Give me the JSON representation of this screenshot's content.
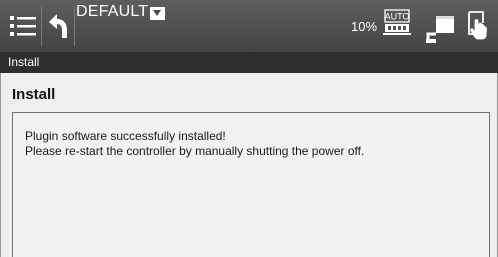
{
  "toolbar": {
    "menu_icon": "menu-icon",
    "undo_icon": "undo-icon",
    "profile_label": "DEFAULT",
    "profile_dropdown_icon": "dropdown-arrow-icon",
    "percent": "10%",
    "auto_icon": "auto-mode-icon",
    "monitor_icon": "display-monitor-icon",
    "hand_icon": "hand-touch-icon"
  },
  "breadcrumb": {
    "label": "Install"
  },
  "main": {
    "title": "Install",
    "message": {
      "line1": "Plugin software successfully installed!",
      "line2": "Please re-start the controller by manually shutting the power off."
    }
  },
  "colors": {
    "toolbar_bg": "#4f4f4f",
    "breadcrumb_bg": "#2f2f2f",
    "content_bg": "#efefef"
  }
}
